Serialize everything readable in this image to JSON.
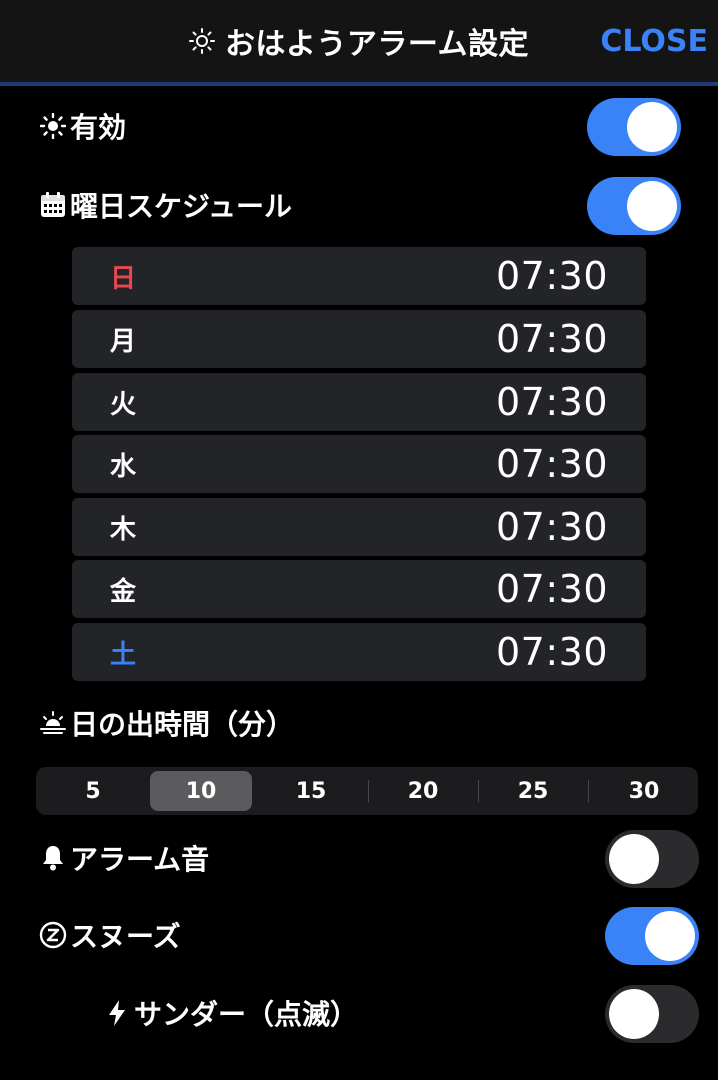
{
  "header": {
    "title": "おはようアラーム設定",
    "close_label": "CLOSE"
  },
  "enabled": {
    "label": "有効",
    "icon": "sun-icon",
    "on": true
  },
  "weekday_schedule": {
    "label": "曜日スケジュール",
    "icon": "calendar-icon",
    "on": true,
    "days": [
      {
        "day": "日",
        "time": "07:30",
        "color": "#e5484d"
      },
      {
        "day": "月",
        "time": "07:30",
        "color": "#ffffff"
      },
      {
        "day": "火",
        "time": "07:30",
        "color": "#ffffff"
      },
      {
        "day": "水",
        "time": "07:30",
        "color": "#ffffff"
      },
      {
        "day": "木",
        "time": "07:30",
        "color": "#ffffff"
      },
      {
        "day": "金",
        "time": "07:30",
        "color": "#ffffff"
      },
      {
        "day": "土",
        "time": "07:30",
        "color": "#3a82f7"
      }
    ]
  },
  "sunrise_time": {
    "label": "日の出時間（分）",
    "icon": "sunrise-icon",
    "options": [
      "5",
      "10",
      "15",
      "20",
      "25",
      "30"
    ],
    "selected": "10"
  },
  "alarm_sound": {
    "label": "アラーム音",
    "icon": "bell-icon",
    "on": false
  },
  "snooze": {
    "label": "スヌーズ",
    "icon": "snooze-icon",
    "on": true
  },
  "thunder": {
    "label": "サンダー（点滅）",
    "icon": "lightning-icon",
    "on": false
  },
  "colors": {
    "accent": "#3a82f7",
    "sunday": "#e5484d",
    "saturday": "#3a82f7"
  }
}
